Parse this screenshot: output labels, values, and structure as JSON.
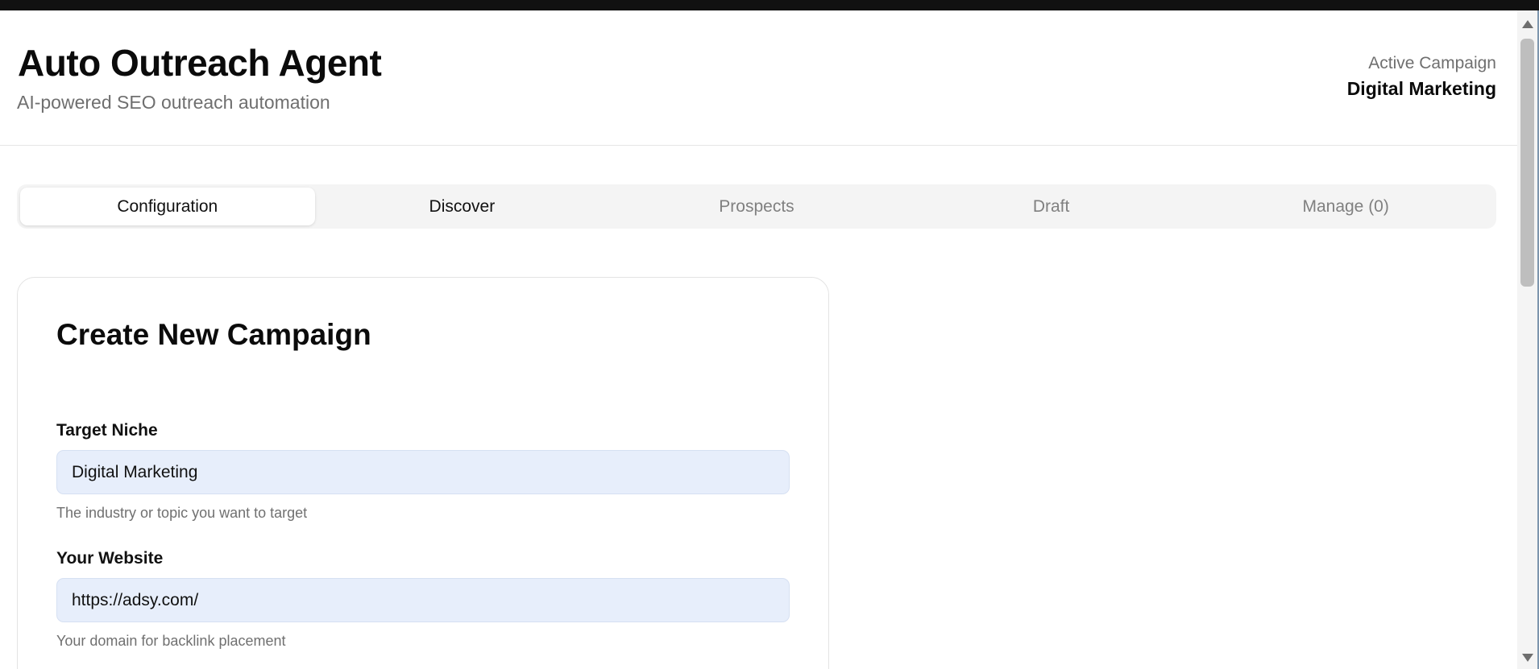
{
  "header": {
    "title": "Auto Outreach Agent",
    "subtitle": "AI-powered SEO outreach automation",
    "active_campaign_label": "Active Campaign",
    "active_campaign_value": "Digital Marketing"
  },
  "tabs": [
    {
      "label": "Configuration",
      "state": "active"
    },
    {
      "label": "Discover",
      "state": "enabled"
    },
    {
      "label": "Prospects",
      "state": "muted"
    },
    {
      "label": "Draft",
      "state": "muted"
    },
    {
      "label": "Manage (0)",
      "state": "muted"
    }
  ],
  "form": {
    "title": "Create New Campaign",
    "fields": [
      {
        "label": "Target Niche",
        "value": "Digital Marketing",
        "help": "The industry or topic you want to target"
      },
      {
        "label": "Your Website",
        "value": "https://adsy.com/",
        "help": "Your domain for backlink placement"
      }
    ]
  },
  "colors": {
    "input_background": "#e7eefb",
    "tab_bar_background": "#f4f4f4",
    "muted_text": "#808080"
  }
}
